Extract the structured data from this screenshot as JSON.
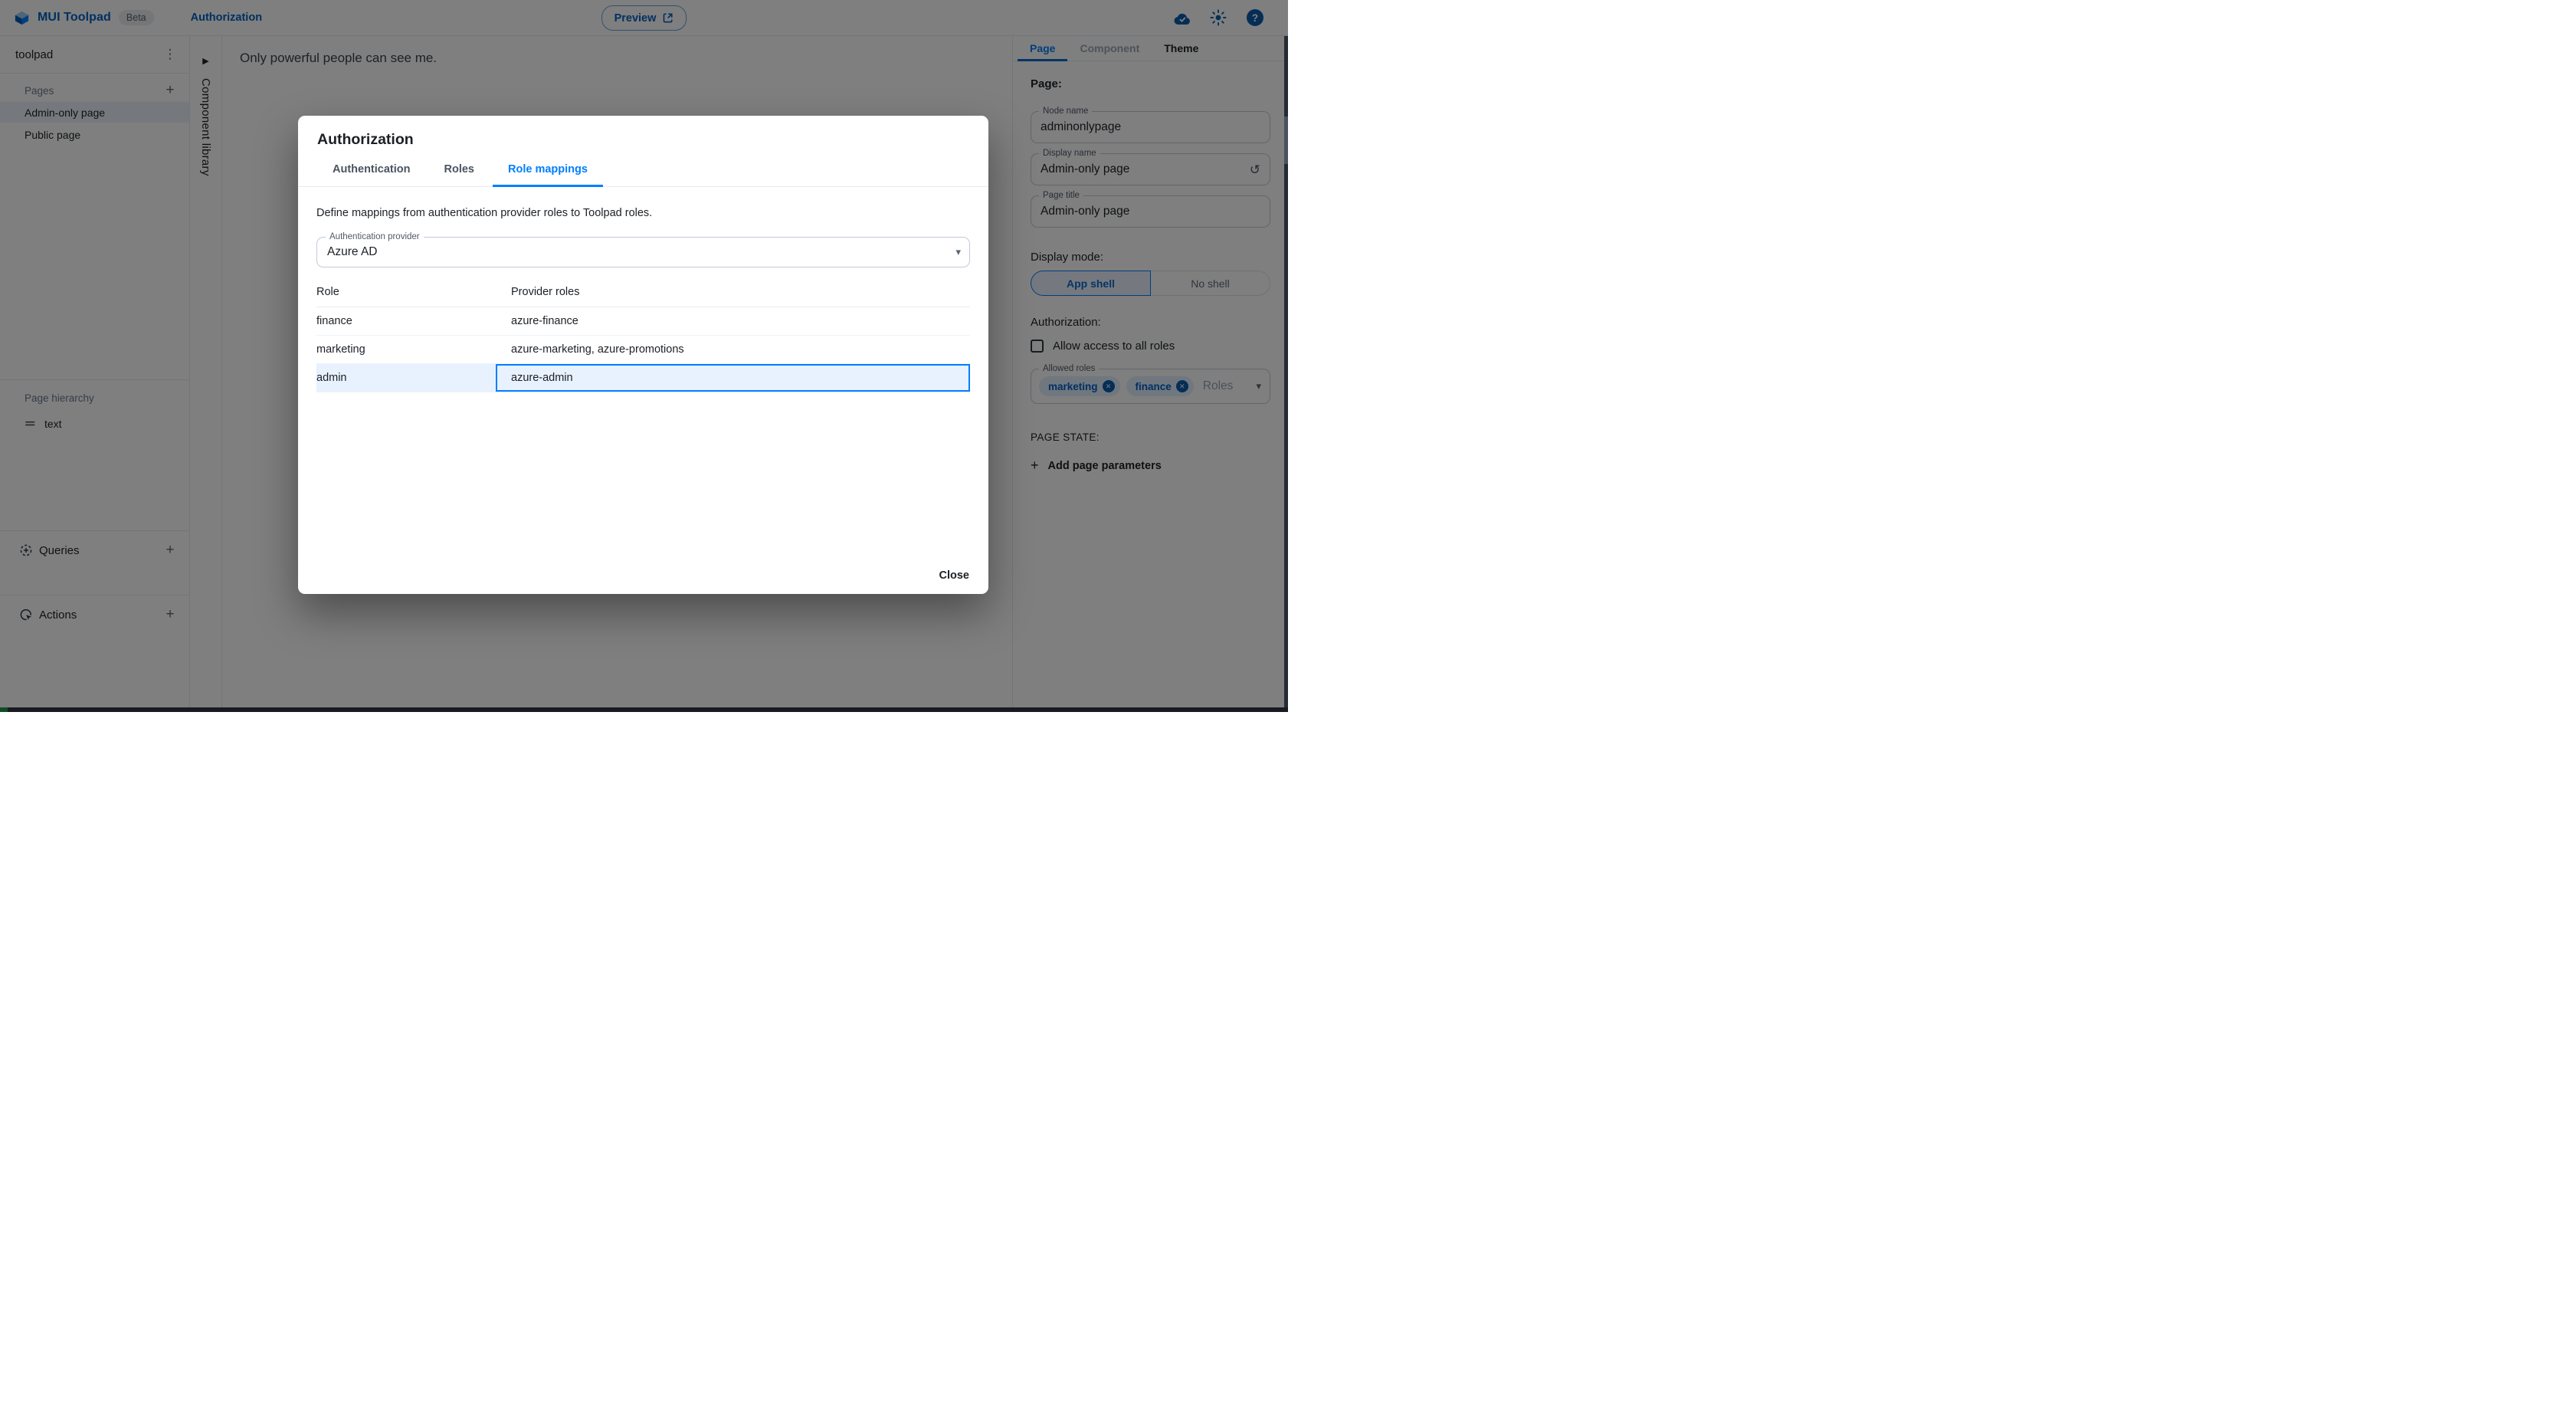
{
  "colors": {
    "accent_blue": "#007FFF",
    "dark_blue": "#0B5CAD",
    "text_primary": "#1C2025",
    "text_secondary": "#6B7A90",
    "divider": "#E5EAF2",
    "selected_row_bg": "#E8F1FE",
    "backdrop": "rgba(0,0,0,0.5)"
  },
  "icons": {
    "kebab": "⋮",
    "plus": "+",
    "caret_down": "▾",
    "reset": "↺",
    "chip_remove": "✕",
    "collapse_arrow": "▶",
    "help": "?"
  },
  "header": {
    "app_title": "MUI Toolpad",
    "beta": "Beta",
    "breadcrumb": "Authorization",
    "preview": "Preview"
  },
  "sidebar": {
    "project": "toolpad",
    "pages_label": "Pages",
    "pages": [
      {
        "label": "Admin-only page",
        "selected": true
      },
      {
        "label": "Public page",
        "selected": false
      }
    ],
    "hierarchy_label": "Page hierarchy",
    "hierarchy_items": [
      {
        "label": "text"
      }
    ],
    "queries_label": "Queries",
    "actions_label": "Actions"
  },
  "library": {
    "label": "Component library"
  },
  "canvas": {
    "message": "Only powerful people can see me."
  },
  "modal": {
    "title": "Authorization",
    "tabs": [
      {
        "label": "Authentication",
        "active": false
      },
      {
        "label": "Roles",
        "active": false
      },
      {
        "label": "Role mappings",
        "active": true
      }
    ],
    "description": "Define mappings from authentication provider roles to Toolpad roles.",
    "provider_label": "Authentication provider",
    "provider_value": "Azure AD",
    "col_role": "Role",
    "col_provider": "Provider roles",
    "rows": [
      {
        "role": "finance",
        "providers": "azure-finance",
        "selected": false
      },
      {
        "role": "marketing",
        "providers": "azure-marketing, azure-promotions",
        "selected": false
      },
      {
        "role": "admin",
        "providers": "azure-admin",
        "selected": true
      }
    ],
    "close": "Close"
  },
  "inspector": {
    "tab_page": "Page",
    "tab_component": "Component",
    "tab_theme": "Theme",
    "heading": "Page:",
    "node_name_label": "Node name",
    "node_name_value": "adminonlypage",
    "display_name_label": "Display name",
    "display_name_value": "Admin-only page",
    "page_title_label": "Page title",
    "page_title_value": "Admin-only page",
    "display_mode_label": "Display mode:",
    "opt_app_shell": "App shell",
    "opt_no_shell": "No shell",
    "authorization_label": "Authorization:",
    "allow_all_label": "Allow access to all roles",
    "allowed_roles_label": "Allowed roles",
    "chips": [
      "marketing",
      "finance"
    ],
    "roles_placeholder": "Roles",
    "page_state_label": "PAGE STATE:",
    "add_params_label": "Add page parameters"
  }
}
